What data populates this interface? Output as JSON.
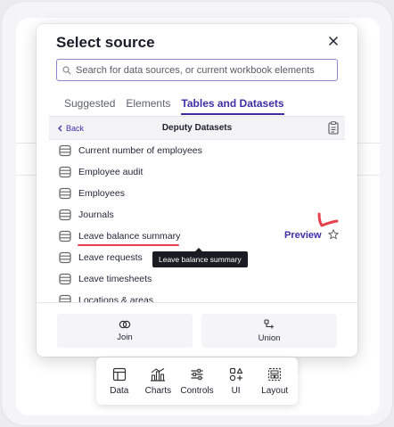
{
  "dialog": {
    "title": "Select source",
    "search": {
      "placeholder": "Search for data sources, or current workbook elements",
      "value": ""
    },
    "tabs": [
      {
        "label": "Suggested",
        "active": false
      },
      {
        "label": "Elements",
        "active": false
      },
      {
        "label": "Tables and Datasets",
        "active": true
      }
    ],
    "subheader": {
      "back_label": "Back",
      "title": "Deputy Datasets"
    },
    "items": [
      {
        "label": "Current number of employees"
      },
      {
        "label": "Employee audit"
      },
      {
        "label": "Employees"
      },
      {
        "label": "Journals"
      },
      {
        "label": "Leave balance summary"
      },
      {
        "label": "Leave requests"
      },
      {
        "label": "Leave timesheets"
      },
      {
        "label": "Locations & areas"
      }
    ],
    "hovered": {
      "preview_label": "Preview",
      "tooltip": "Leave balance summary"
    },
    "footer": {
      "join_label": "Join",
      "union_label": "Union"
    }
  },
  "toolbar": {
    "items": [
      {
        "label": "Data",
        "icon": "table-icon"
      },
      {
        "label": "Charts",
        "icon": "charts-icon"
      },
      {
        "label": "Controls",
        "icon": "sliders-icon"
      },
      {
        "label": "UI",
        "icon": "ui-elements-icon"
      },
      {
        "label": "Layout",
        "icon": "layout-icon"
      }
    ]
  },
  "colors": {
    "accent": "#3e2fa8",
    "annotation": "#e8414e",
    "tooltip_bg": "#1b1b22"
  }
}
